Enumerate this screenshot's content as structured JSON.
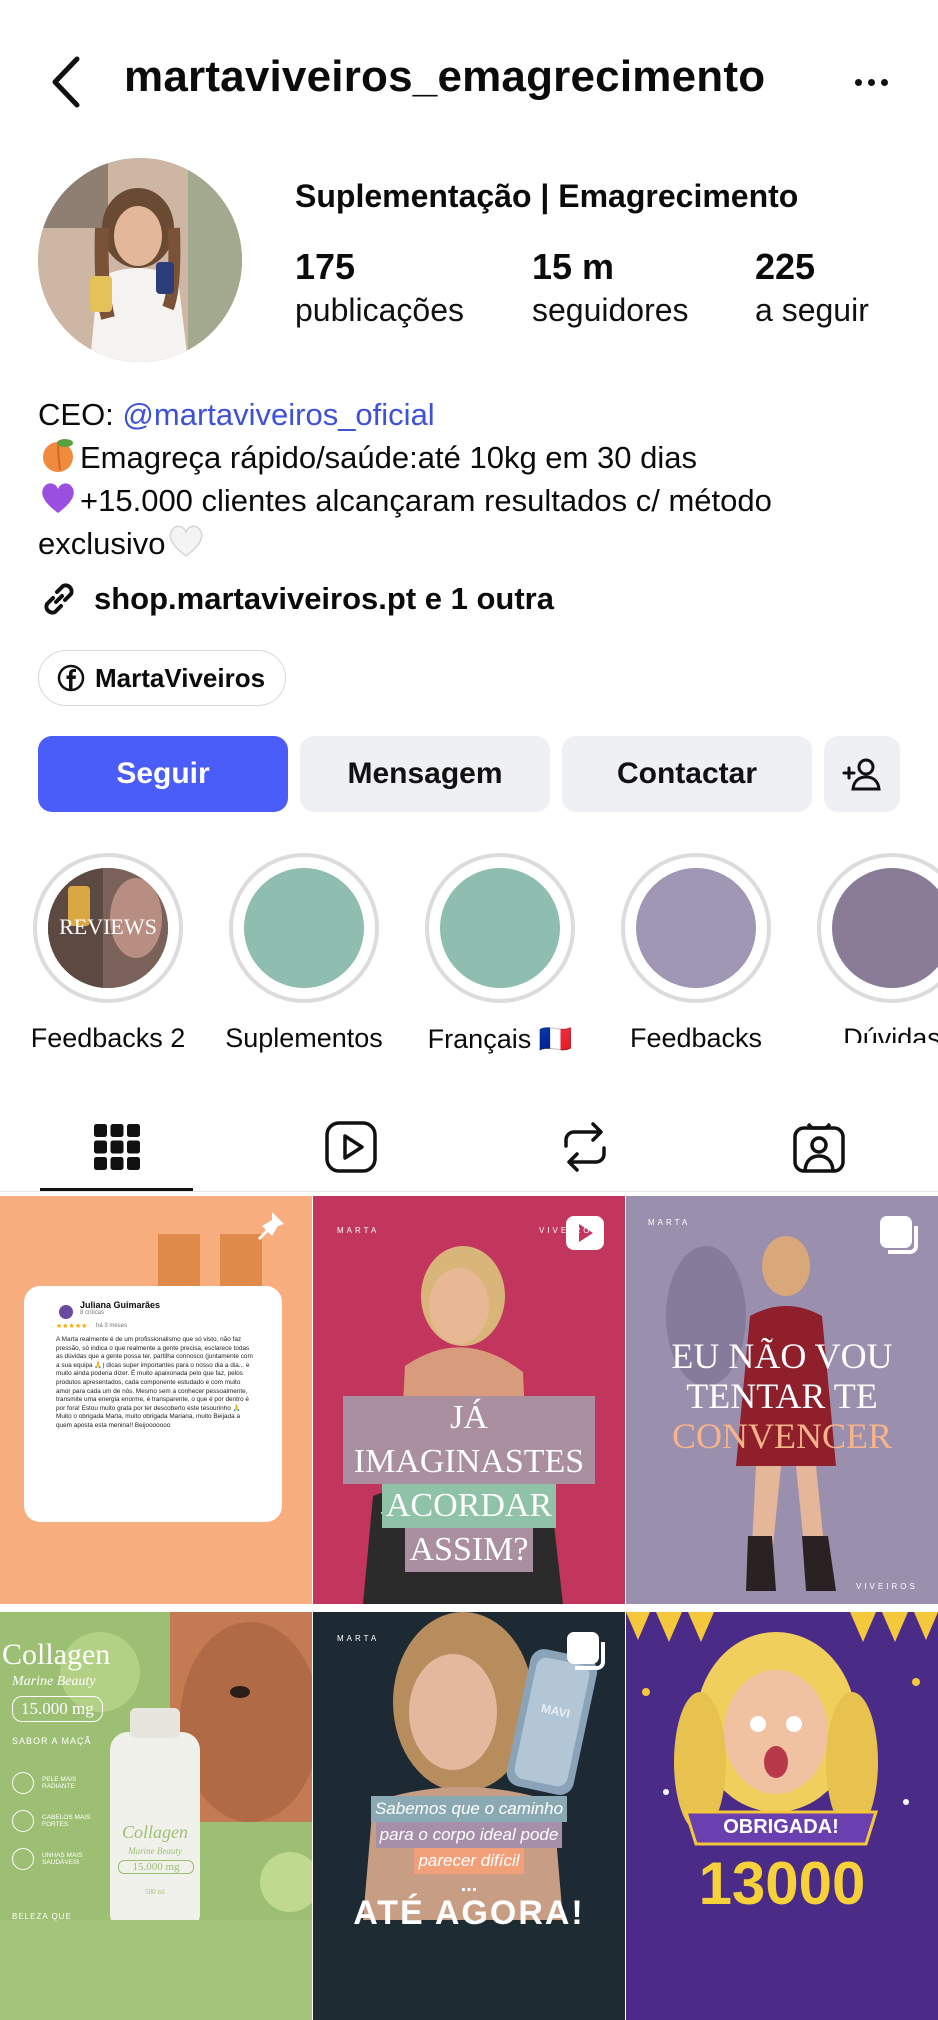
{
  "header": {
    "username": "martaviveiros_emagrecimento",
    "back_icon": "chevron-left-icon",
    "more_icon": "more-horizontal-icon"
  },
  "profile": {
    "display_name": "Suplementação | Emagrecimento",
    "stats": [
      {
        "value": "175",
        "label": "publicações"
      },
      {
        "value": "15 m",
        "label": "seguidores"
      },
      {
        "value": "225",
        "label": "a seguir"
      }
    ],
    "bio": {
      "ceo_prefix": "CEO: ",
      "ceo_mention": "@martaviveiros_oficial",
      "line2": "Emagreça rápido/saúde:até 10kg em 30 dias",
      "line3": "+15.000 clientes alcançaram resultados c/  método",
      "line4": "exclusivo"
    },
    "link": "shop.martaviveiros.pt e 1 outra",
    "facebook": "MartaViveiros"
  },
  "actions": {
    "follow": "Seguir",
    "message": "Mensagem",
    "contact": "Contactar"
  },
  "highlights": [
    {
      "label": "Feedbacks 2",
      "cover_text": "REVIEWS"
    },
    {
      "label": "Suplementos",
      "color": "#8fbeb0"
    },
    {
      "label": "Français 🇫🇷",
      "color": "#8fbeb0"
    },
    {
      "label": "Feedbacks",
      "color": "#9f97b3"
    },
    {
      "label": "Dúvidas",
      "color": "#8a7c97"
    }
  ],
  "tabs": [
    "grid",
    "reels",
    "reposts",
    "tagged"
  ],
  "posts": [
    {
      "type": "review",
      "pinned": true,
      "review_name": "Juliana Guimarães",
      "review_sub": "8 críticas",
      "review_time": "há 3 meses",
      "review_body": "A Marta realmente é de um profissionalismo que só visto, não faz pressão, só indica o que realmente a gente precisa, esclarece todas as dúvidas que a gente possa ter, partilha connosco (juntamente com a sua equipa 🙏) dicas super importantes para o nosso dia a dia... e muito ainda poderia dizer. É muito apaixonada pelo que faz, pelos produtos apresentados, cada componente estudado e com muito amor para cada um de nós. Mesmo sem a conhecer pessoalmente, transmite uma energia enorme, é transparente, o que é por dentro é por fora! Estou muito grata por ter descoberto este tesourinho 🙏 Muito o obrigada Marta, muito obrigada Mariana, muito Beijada a quem aposta esta menina!! Beijooooooo"
    },
    {
      "type": "reel",
      "brand_left": "MARTA",
      "brand_right": "VIVEIROS",
      "lines": [
        "JÁ IMAGINASTES",
        "ACORDAR",
        "ASSIM?"
      ]
    },
    {
      "type": "carousel",
      "brand_left": "MARTA",
      "brand_right": "VIVEIROS",
      "lines": [
        "EU NÃO VOU",
        "TENTAR TE",
        "CONVENCER"
      ]
    },
    {
      "type": "product",
      "title": "Collagen",
      "subtitle": "Marine Beauty",
      "dose": "15.000 mg",
      "flavor": "SABOR A MAÇÃ",
      "benefits": [
        "PELE MAIS RADIANTE",
        "CABELOS MAIS FORTES",
        "UNHAS MAIS SAUDÁVEIS"
      ],
      "footer": "BELEZA QUE",
      "bottle_title": "Collagen",
      "bottle_sub": "Marine Beauty",
      "bottle_dose": "15.000 mg",
      "bottle_volume": "500 ml"
    },
    {
      "type": "carousel",
      "brand_left": "MARTA",
      "phone_label": "MAVI",
      "lines": [
        "Sabemos que o caminho",
        "para o corpo ideal pode",
        "parecer difícil"
      ],
      "ellipsis": "...",
      "big": "ATÉ AGORA!"
    },
    {
      "type": "celebration",
      "banner": "OBRIGADA!",
      "number": "13000"
    }
  ]
}
